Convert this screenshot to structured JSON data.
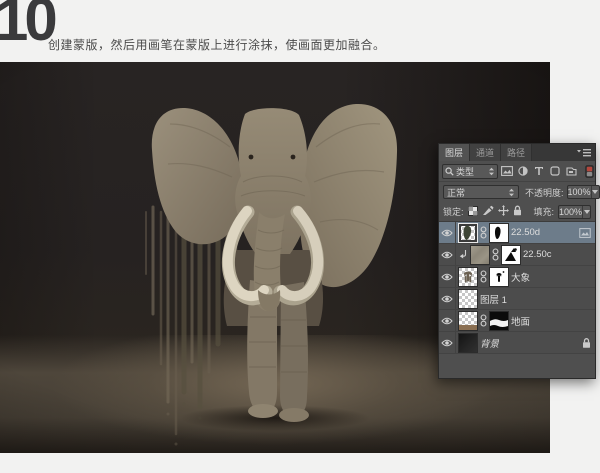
{
  "page": {
    "background": "#f2f2f1"
  },
  "header": {
    "step_number": "10",
    "description": "创建蒙版，然后用画笔在蒙版上进行涂抹，使画面更加融合。"
  },
  "canvas": {
    "background_color": "#262221",
    "ground_color": "#5e5345",
    "elephant_body_color": "#8f8471",
    "tusk_color": "#ddd5c1"
  },
  "panel": {
    "tabs": [
      {
        "label": "图层",
        "active": true
      },
      {
        "label": "通道",
        "active": false
      },
      {
        "label": "路径",
        "active": false
      }
    ],
    "filter_row": {
      "kind_label": "类型"
    },
    "blend_row": {
      "mode": "正常",
      "opacity_label": "不透明度:",
      "opacity_value": "100%"
    },
    "lock_row": {
      "lock_label": "锁定:",
      "fill_label": "填充:",
      "fill_value": "100%"
    },
    "layers": [
      {
        "name": "22.50d",
        "selected": true,
        "has_mask": true,
        "badge": true
      },
      {
        "name": "22.50c",
        "clipped": true,
        "has_mask": true
      },
      {
        "name": "大象",
        "has_mask": true
      },
      {
        "name": "图层 1"
      },
      {
        "name": "地面",
        "has_mask": true
      },
      {
        "name": "背景",
        "locked": true
      }
    ],
    "colors": {
      "panel_bg": "#4f4f4f",
      "tab_bar_bg": "#373737",
      "selected_row": "#6d7c8a",
      "text": "#d6d6d6"
    }
  }
}
